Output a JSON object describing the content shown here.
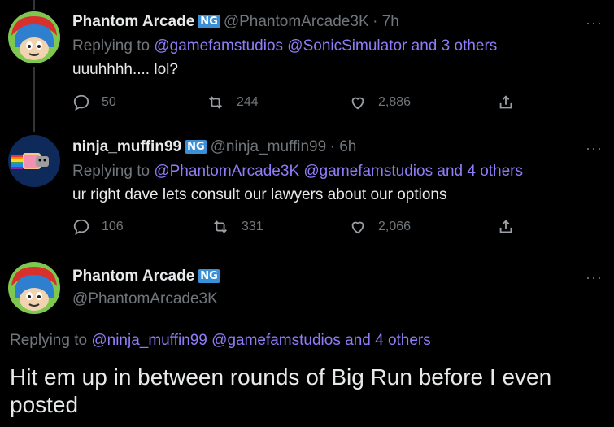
{
  "tweets": [
    {
      "display_name": "Phantom Arcade",
      "badge": "NG",
      "handle": "@PhantomArcade3K",
      "time": "· 7h",
      "replying_label": "Replying to",
      "replying_to": "@gamefamstudios @SonicSimulator",
      "replying_more": "and 3 others",
      "text": "uuuhhhh.... lol?",
      "replies": "50",
      "retweets": "244",
      "likes": "2,886"
    },
    {
      "display_name": "ninja_muffin99",
      "badge": "NG",
      "handle": "@ninja_muffin99",
      "time": "· 6h",
      "replying_label": "Replying to",
      "replying_to": "@PhantomArcade3K @gamefamstudios",
      "replying_more": "and 4 others",
      "text": "ur right dave lets consult our lawyers about our options",
      "replies": "106",
      "retweets": "331",
      "likes": "2,066"
    }
  ],
  "main_tweet": {
    "display_name": "Phantom Arcade",
    "badge": "NG",
    "handle": "@PhantomArcade3K",
    "replying_label": "Replying to",
    "replying_to": "@ninja_muffin99 @gamefamstudios",
    "replying_more": "and 4 others",
    "text": "Hit em up in between rounds of Big Run before I even posted"
  },
  "more_icon": "···",
  "colors": {
    "background": "#000000",
    "link": "#8f7cf7",
    "muted": "#71767b",
    "badge": "#3a8fd6"
  }
}
